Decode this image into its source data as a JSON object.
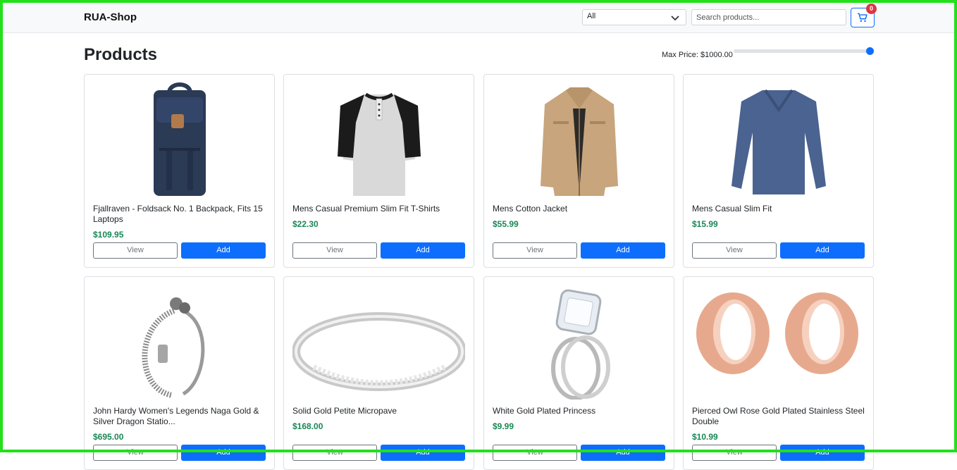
{
  "header": {
    "brand": "RUA-Shop",
    "category_selected": "All",
    "search_placeholder": "Search products...",
    "cart_count": "0",
    "cart_icon": "cart-icon",
    "accent_color": "#0d6efd",
    "badge_color": "#dc3545"
  },
  "page": {
    "title": "Products",
    "max_price_label": "Max Price: $1000.00",
    "max_price_fraction": 1.0
  },
  "buttons": {
    "view_label": "View",
    "add_label": "Add"
  },
  "price_color": "#198754",
  "products": [
    {
      "name": "Fjallraven - Foldsack No. 1 Backpack, Fits 15 Laptops",
      "price": "$109.95",
      "image": "backpack"
    },
    {
      "name": "Mens Casual Premium Slim Fit T-Shirts",
      "price": "$22.30",
      "image": "raglan-tshirt"
    },
    {
      "name": "Mens Cotton Jacket",
      "price": "$55.99",
      "image": "jacket"
    },
    {
      "name": "Mens Casual Slim Fit",
      "price": "$15.99",
      "image": "longsleeve-shirt"
    },
    {
      "name": "John Hardy Women's Legends Naga Gold & Silver Dragon Statio...",
      "price": "$695.00",
      "image": "dragon-bracelet"
    },
    {
      "name": "Solid Gold Petite Micropave",
      "price": "$168.00",
      "image": "silver-band-ring"
    },
    {
      "name": "White Gold Plated Princess",
      "price": "$9.99",
      "image": "diamond-ring"
    },
    {
      "name": "Pierced Owl Rose Gold Plated Stainless Steel Double",
      "price": "$10.99",
      "image": "rose-gold-tunnels"
    }
  ]
}
